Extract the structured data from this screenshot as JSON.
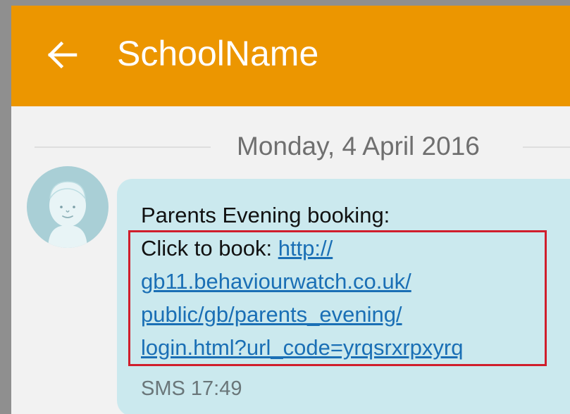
{
  "appbar": {
    "title": "SchoolName",
    "back_icon": "arrow-left-icon",
    "color": "#ec9600"
  },
  "conversation": {
    "date_separator": "Monday, 4 April 2016",
    "message": {
      "line1": "Parents Evening booking:",
      "click_prefix": "Click to book: ",
      "link_line1": "http://",
      "link_line2": "gb11.behaviourwatch.co.uk/",
      "link_line3": "public/gb/parents_evening/",
      "link_line4": "login.html?url_code=yrqsrxrpxyrq",
      "meta": "SMS 17:49",
      "bubble_color": "#cbe9ee",
      "link_color": "#1a6fb5",
      "highlight_color": "#d01e2c"
    },
    "sender_avatar_icon": "person-avatar-icon"
  }
}
